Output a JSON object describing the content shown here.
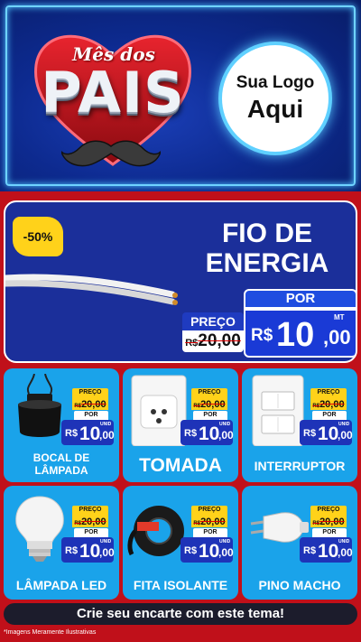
{
  "header": {
    "title_script": "Mês dos",
    "title_main": "PAIS",
    "logo_line1": "Sua Logo",
    "logo_line2": "Aqui"
  },
  "featured": {
    "badge": "-50%",
    "name_line1": "FIO DE",
    "name_line2": "ENERGIA",
    "por_label": "POR",
    "preco_label": "PREÇO",
    "old_currency": "R$",
    "old_price": "20,00",
    "new_currency": "R$",
    "new_price": "10",
    "new_cents": ",00",
    "unit": "MT"
  },
  "products": [
    {
      "name": "BOCAL DE LÂMPADA",
      "preco_label": "PREÇO",
      "old_currency": "R$",
      "old_price": "20,00",
      "por_label": "POR",
      "currency": "R$",
      "price": "10",
      "cents": ",00",
      "unit": "UNID",
      "icon": "lamp-socket-icon"
    },
    {
      "name": "TOMADA",
      "preco_label": "PREÇO",
      "old_currency": "R$",
      "old_price": "20,00",
      "por_label": "POR",
      "currency": "R$",
      "price": "10",
      "cents": ",00",
      "unit": "UNID",
      "icon": "outlet-icon"
    },
    {
      "name": "INTERRUPTOR",
      "preco_label": "PREÇO",
      "old_currency": "R$",
      "old_price": "20,00",
      "por_label": "POR",
      "currency": "R$",
      "price": "10",
      "cents": ",00",
      "unit": "UNID",
      "icon": "switch-icon"
    },
    {
      "name": "LÂMPADA LED",
      "preco_label": "PREÇO",
      "old_currency": "R$",
      "old_price": "20,00",
      "por_label": "POR",
      "currency": "R$",
      "price": "10",
      "cents": ",00",
      "unit": "UNID",
      "icon": "led-bulb-icon"
    },
    {
      "name": "FITA ISOLANTE",
      "preco_label": "PREÇO",
      "old_currency": "R$",
      "old_price": "20,00",
      "por_label": "POR",
      "currency": "R$",
      "price": "10",
      "cents": ",00",
      "unit": "UNID",
      "icon": "tape-icon"
    },
    {
      "name": "PINO MACHO",
      "preco_label": "PREÇO",
      "old_currency": "R$",
      "old_price": "20,00",
      "por_label": "POR",
      "currency": "R$",
      "price": "10",
      "cents": ",00",
      "unit": "UNID",
      "icon": "plug-icon"
    }
  ],
  "cta": "Crie seu encarte com este tema!",
  "disclaimer": "*Imagens Meramente Ilustrativas",
  "colors": {
    "header_bg": "#0d2a8f",
    "content_bg": "#c0101a",
    "card_bg": "#1aa3ea",
    "badge_yellow": "#ffd21a",
    "price_blue": "#1e33b8"
  }
}
